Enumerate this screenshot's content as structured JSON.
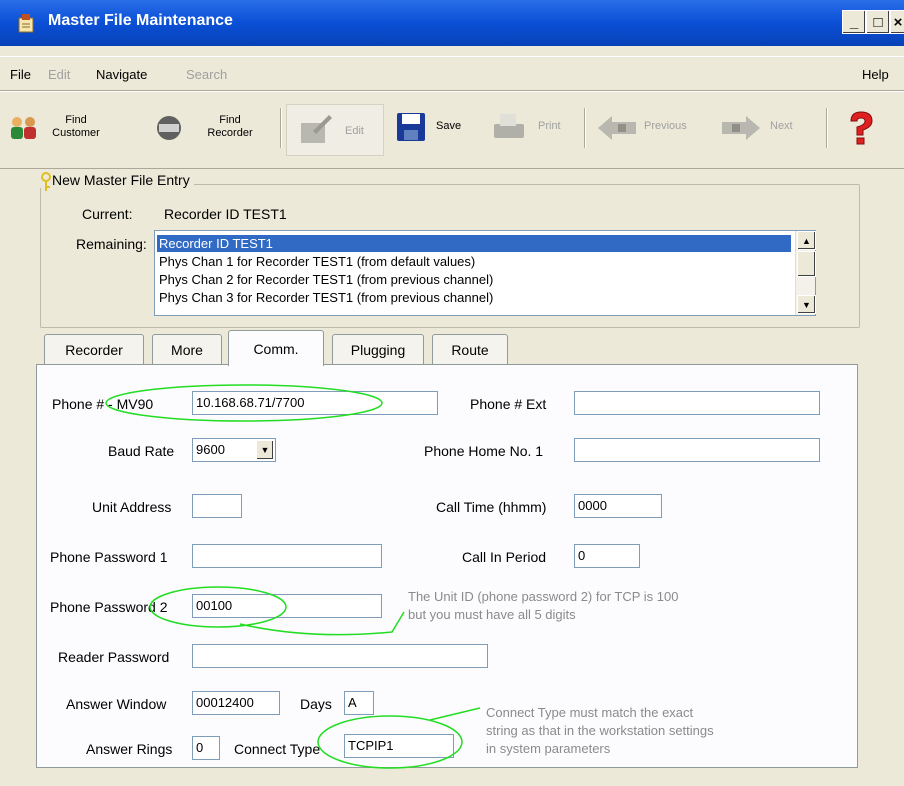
{
  "window": {
    "title": "Master File Maintenance"
  },
  "menu": {
    "file": "File",
    "edit": "Edit",
    "navigate": "Navigate",
    "search": "Search",
    "help": "Help"
  },
  "toolbar": {
    "find_customer": [
      "Find",
      "Customer"
    ],
    "find_recorder": [
      "Find",
      "Recorder"
    ],
    "edit": "Edit",
    "save": "Save",
    "print": "Print",
    "previous": "Previous",
    "next": "Next"
  },
  "entry": {
    "group_title": "New Master File Entry",
    "current_label": "Current:",
    "current_value": "Recorder ID TEST1",
    "remaining_label": "Remaining:",
    "remaining_items": [
      "Recorder ID TEST1",
      "Phys Chan 1 for Recorder TEST1 (from default values)",
      "Phys Chan 2 for Recorder TEST1 (from previous channel)",
      "Phys Chan 3 for Recorder TEST1 (from previous channel)"
    ]
  },
  "tabs": [
    "Recorder",
    "More",
    "Comm.",
    "Plugging",
    "Route"
  ],
  "form": {
    "phone_mv90_label": "Phone # - MV90",
    "phone_mv90_value": "10.168.68.71/7700",
    "phone_ext_label": "Phone # Ext",
    "phone_ext_value": "",
    "baud_rate_label": "Baud Rate",
    "baud_rate_value": "9600",
    "phone_home_label": "Phone Home No. 1",
    "phone_home_value": "",
    "unit_address_label": "Unit Address",
    "unit_address_value": "",
    "call_time_label": "Call Time (hhmm)",
    "call_time_value": "0000",
    "phone_password1_label": "Phone Password 1",
    "phone_password1_value": "",
    "call_in_period_label": "Call In Period",
    "call_in_period_value": "0",
    "phone_password2_label": "Phone Password 2",
    "phone_password2_value": "00100",
    "reader_password_label": "Reader Password",
    "reader_password_value": "",
    "answer_window_label": "Answer Window",
    "answer_window_value": "00012400",
    "days_label": "Days",
    "days_value": "A",
    "answer_rings_label": "Answer Rings",
    "answer_rings_value": "0",
    "connect_type_label": "Connect Type",
    "connect_type_value": "TCPIP1"
  },
  "annotations": {
    "note1": [
      "The Unit ID (phone password 2) for TCP is 100",
      "but you must have all 5 digits"
    ],
    "note2": [
      "Connect Type must match the exact",
      "string as that in the workstation settings",
      "in system parameters"
    ],
    "highlight_color": "#22dd22"
  }
}
